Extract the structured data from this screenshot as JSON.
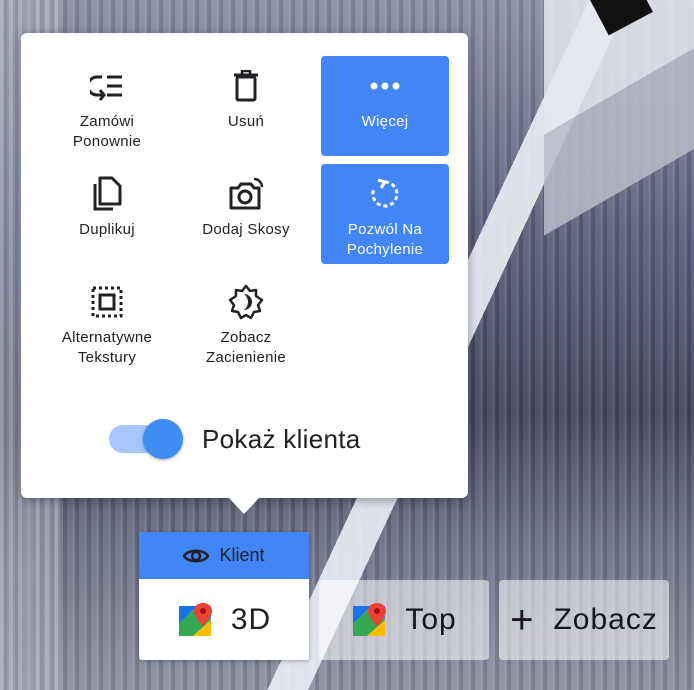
{
  "menu": {
    "items": [
      {
        "label": "Zamówi\nPonownie",
        "icon": "reorder-icon",
        "active": false
      },
      {
        "label": "Usuń",
        "icon": "trash-icon",
        "active": false
      },
      {
        "label": "Więcej",
        "icon": "more-icon",
        "active": true
      },
      {
        "label": "Duplikuj",
        "icon": "duplicate-icon",
        "active": false
      },
      {
        "label": "Dodaj Skosy",
        "icon": "camera-rotate-icon",
        "active": false
      },
      {
        "label": "Pozwól Na\nPochylenie",
        "icon": "rotate-icon",
        "active": true
      },
      {
        "label": "Alternatywne\nTekstury",
        "icon": "texture-icon",
        "active": false
      },
      {
        "label": "Zobacz\nZacienienie",
        "icon": "shading-icon",
        "active": false
      }
    ],
    "toggle": {
      "label": "Pokaż klienta",
      "on": true
    }
  },
  "view_buttons": {
    "client_label": "Klient",
    "mode_3d": "3D",
    "mode_top": "Top",
    "see_label": "Zobacz"
  },
  "colors": {
    "accent": "#4285f4",
    "toggle_track": "#a7c6fa",
    "panel": "#ffffff"
  }
}
